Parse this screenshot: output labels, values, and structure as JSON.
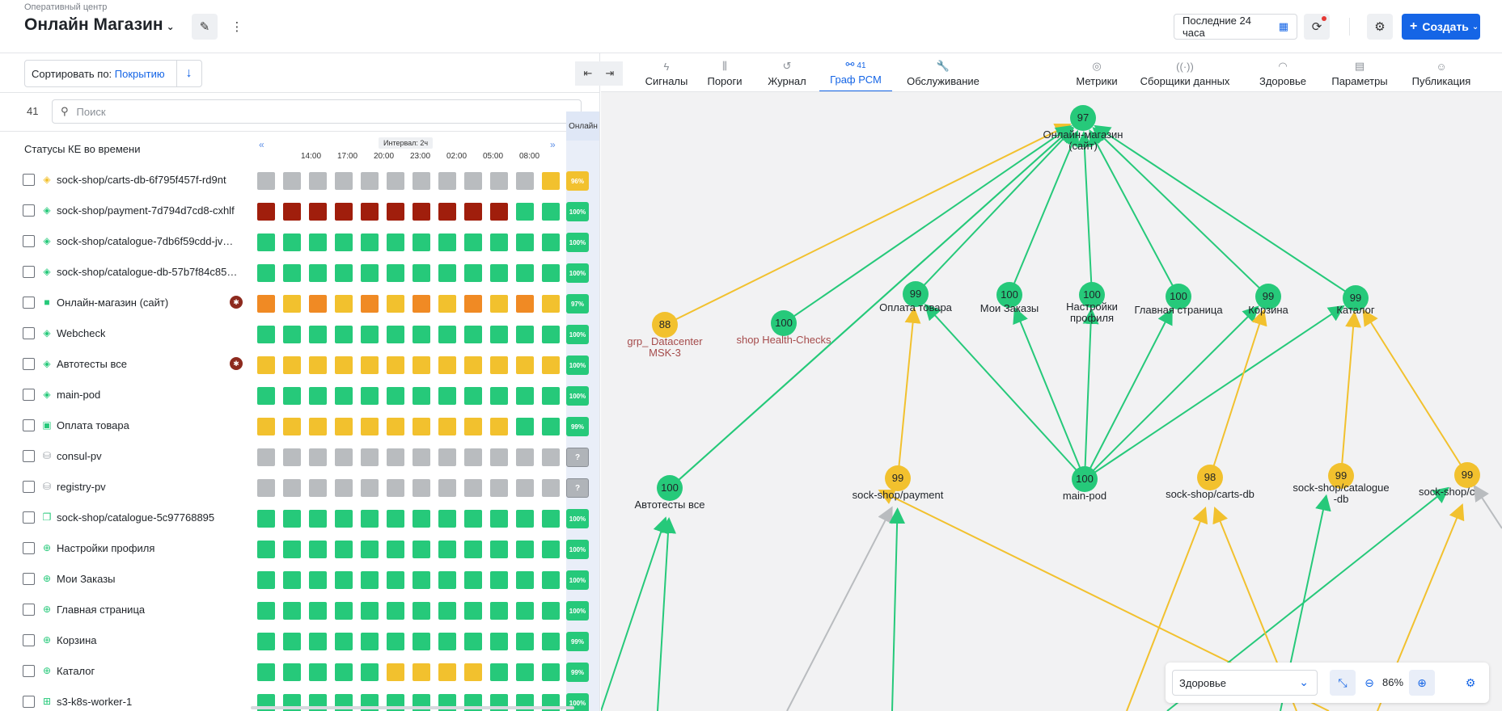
{
  "header": {
    "breadcrumb": "Оперативный центр",
    "title": "Онлайн Магазин",
    "time_range": "Последние 24 часа",
    "create_label": "Создать"
  },
  "left": {
    "sort_label": "Сортировать по:",
    "sort_value": "Покрытию",
    "count": "41",
    "search_placeholder": "Поиск",
    "panel_title": "Статусы КЕ во времени",
    "interval_label": "Интервал: 2ч",
    "online_label": "Онлайн",
    "times": [
      "14:00",
      "17:00",
      "20:00",
      "23:00",
      "02:00",
      "05:00",
      "08:00"
    ],
    "rows": [
      {
        "label": "sock-shop/carts-db-6f795f457f-rd9nt",
        "icon": "layers-icon",
        "icon_color": "#f2c12e",
        "cells": "GGGGGGGGGGGY",
        "badge": "96%",
        "badge_color": "#f2c12e",
        "alert": false
      },
      {
        "label": "sock-shop/payment-7d794d7cd8-cxhlf",
        "icon": "layers-icon",
        "icon_color": "#26c97a",
        "cells": "RRRRRRRRRRgg",
        "badge": "100%",
        "badge_color": "#26c97a",
        "alert": false
      },
      {
        "label": "sock-shop/catalogue-7db6f59cdd-jv8dd",
        "icon": "layers-icon",
        "icon_color": "#26c97a",
        "cells": "gggggggggggg",
        "badge": "100%",
        "badge_color": "#26c97a",
        "alert": false
      },
      {
        "label": "sock-shop/catalogue-db-57b7f84c85-…",
        "icon": "layers-icon",
        "icon_color": "#26c97a",
        "cells": "gggggggggggg",
        "badge": "100%",
        "badge_color": "#26c97a",
        "alert": false
      },
      {
        "label": "Онлайн-магазин (сайт)",
        "icon": "briefcase-icon",
        "icon_color": "#26c97a",
        "cells": "OYOYOYOYOYOY",
        "badge": "97%",
        "badge_color": "#26c97a",
        "alert": true
      },
      {
        "label": "Webcheck",
        "icon": "layers-icon",
        "icon_color": "#26c97a",
        "cells": "gggggggggggg",
        "badge": "100%",
        "badge_color": "#26c97a",
        "alert": false
      },
      {
        "label": "Автотесты все",
        "icon": "layers-icon",
        "icon_color": "#26c97a",
        "cells": "YYYYYYYYYYYY",
        "badge": "100%",
        "badge_color": "#26c97a",
        "alert": true
      },
      {
        "label": "main-pod",
        "icon": "layers-icon",
        "icon_color": "#26c97a",
        "cells": "gggggggggggg",
        "badge": "100%",
        "badge_color": "#26c97a",
        "alert": false
      },
      {
        "label": "Оплата товара",
        "icon": "monitor-icon",
        "icon_color": "#26c97a",
        "cells": "YYYYYYYYYYgg",
        "badge": "99%",
        "badge_color": "#26c97a",
        "alert": false
      },
      {
        "label": "consul-pv",
        "icon": "disk-icon",
        "icon_color": "#9aa0a6",
        "cells": "GGGGGGGGGGGG",
        "badge": "?",
        "badge_color": "#b0b4b9",
        "alert": false
      },
      {
        "label": "registry-pv",
        "icon": "disk-icon",
        "icon_color": "#9aa0a6",
        "cells": "GGGGGGGGGGGG",
        "badge": "?",
        "badge_color": "#b0b4b9",
        "alert": false
      },
      {
        "label": "sock-shop/catalogue-5c97768895",
        "icon": "copy-icon",
        "icon_color": "#26c97a",
        "cells": "gggggggggggg",
        "badge": "100%",
        "badge_color": "#26c97a",
        "alert": false
      },
      {
        "label": "Настройки профиля",
        "icon": "globe-icon",
        "icon_color": "#26c97a",
        "cells": "gggggggggggg",
        "badge": "100%",
        "badge_color": "#26c97a",
        "alert": false
      },
      {
        "label": "Мои Заказы",
        "icon": "globe-icon",
        "icon_color": "#26c97a",
        "cells": "gggggggggggg",
        "badge": "100%",
        "badge_color": "#26c97a",
        "alert": false
      },
      {
        "label": "Главная страница",
        "icon": "globe-icon",
        "icon_color": "#26c97a",
        "cells": "gggggggggggg",
        "badge": "100%",
        "badge_color": "#26c97a",
        "alert": false
      },
      {
        "label": "Корзина",
        "icon": "globe-icon",
        "icon_color": "#26c97a",
        "cells": "gggggggggggg",
        "badge": "99%",
        "badge_color": "#26c97a",
        "alert": false
      },
      {
        "label": "Каталог",
        "icon": "globe-icon",
        "icon_color": "#26c97a",
        "cells": "gggggYYYYggg",
        "badge": "99%",
        "badge_color": "#26c97a",
        "alert": false
      },
      {
        "label": "s3-k8s-worker-1",
        "icon": "server-icon",
        "icon_color": "#26c97a",
        "cells": "gggggggggggg",
        "badge": "100%",
        "badge_color": "#26c97a",
        "alert": false
      }
    ]
  },
  "tabs_left": [
    {
      "label": "Сигналы",
      "icon": "signal-icon",
      "badge": ""
    },
    {
      "label": "Пороги",
      "icon": "threshold-icon",
      "badge": ""
    },
    {
      "label": "Журнал",
      "icon": "history-icon",
      "badge": ""
    },
    {
      "label": "Граф РСМ",
      "icon": "graph-icon",
      "badge": "41"
    },
    {
      "label": "Обслуживание",
      "icon": "wrench-icon",
      "badge": ""
    }
  ],
  "tabs_right": [
    {
      "label": "Метрики",
      "icon": "metrics-icon"
    },
    {
      "label": "Сборщики данных",
      "icon": "broadcast-icon"
    },
    {
      "label": "Здоровье",
      "icon": "health-icon"
    },
    {
      "label": "Параметры",
      "icon": "params-icon"
    },
    {
      "label": "Публикация",
      "icon": "users-icon"
    }
  ],
  "graph": {
    "nodes": [
      {
        "id": "site",
        "score": "97",
        "label": "Онлайн-магазин (сайт)",
        "color": "#26c97a",
        "label_color": "#1f2328"
      },
      {
        "id": "dc",
        "score": "88",
        "label": "grp_ Datacenter MSK-3",
        "color": "#f2c12e",
        "label_color": "#a54b4b"
      },
      {
        "id": "hc",
        "score": "100",
        "label": "shop Health-Checks",
        "color": "#26c97a",
        "label_color": "#a54b4b"
      },
      {
        "id": "pay",
        "score": "99",
        "label": "Оплата товара",
        "color": "#26c97a",
        "label_color": "#1f2328"
      },
      {
        "id": "orders",
        "score": "100",
        "label": "Мои Заказы",
        "color": "#26c97a",
        "label_color": "#1f2328"
      },
      {
        "id": "profile",
        "score": "100",
        "label": "Настройки профиля",
        "color": "#26c97a",
        "label_color": "#1f2328"
      },
      {
        "id": "main",
        "score": "100",
        "label": "Главная страница",
        "color": "#26c97a",
        "label_color": "#1f2328"
      },
      {
        "id": "cart",
        "score": "99",
        "label": "Корзина",
        "color": "#26c97a",
        "label_color": "#1f2328"
      },
      {
        "id": "cat",
        "score": "99",
        "label": "Каталог",
        "color": "#26c97a",
        "label_color": "#1f2328"
      },
      {
        "id": "auto",
        "score": "100",
        "label": "Автотесты все",
        "color": "#26c97a",
        "label_color": "#1f2328"
      },
      {
        "id": "sspay",
        "score": "99",
        "label": "sock-shop/payment",
        "color": "#f2c12e",
        "label_color": "#1f2328"
      },
      {
        "id": "mainpod",
        "score": "100",
        "label": "main-pod",
        "color": "#26c97a",
        "label_color": "#1f2328"
      },
      {
        "id": "cartsdb",
        "score": "98",
        "label": "sock-shop/carts-db",
        "color": "#f2c12e",
        "label_color": "#1f2328"
      },
      {
        "id": "catdb",
        "score": "99",
        "label": "sock-shop/catalogue -db",
        "color": "#f2c12e",
        "label_color": "#1f2328"
      },
      {
        "id": "catalog",
        "score": "99",
        "label": "sock-shop/catalo",
        "color": "#f2c12e",
        "label_color": "#1f2328"
      }
    ],
    "filter_value": "Здоровье",
    "zoom": "86%"
  },
  "colors": {
    "green": "#26c97a",
    "yellow": "#f2c12e",
    "orange": "#f08a24",
    "red": "#a01e0c",
    "grey": "#b9bcbf",
    "accent": "#1565e6"
  }
}
